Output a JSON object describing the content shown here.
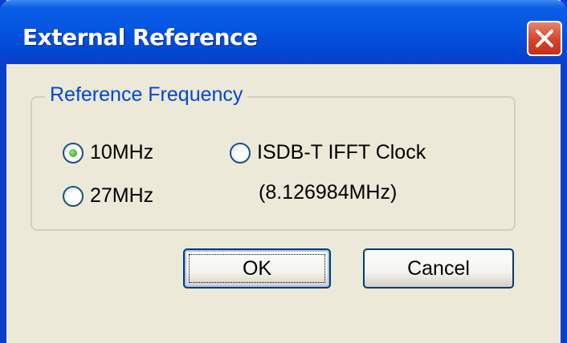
{
  "window": {
    "title": "External Reference",
    "close_icon": "close-icon",
    "titlebar_color": "#0555e0"
  },
  "group": {
    "legend": "Reference Frequency"
  },
  "options": {
    "opt_10mhz": {
      "label": "10MHz",
      "selected": true
    },
    "opt_27mhz": {
      "label": "27MHz",
      "selected": false
    },
    "opt_isdb": {
      "label": "ISDB-T IFFT Clock",
      "sublabel": "(8.126984MHz)",
      "selected": false
    }
  },
  "buttons": {
    "ok": "OK",
    "cancel": "Cancel"
  }
}
